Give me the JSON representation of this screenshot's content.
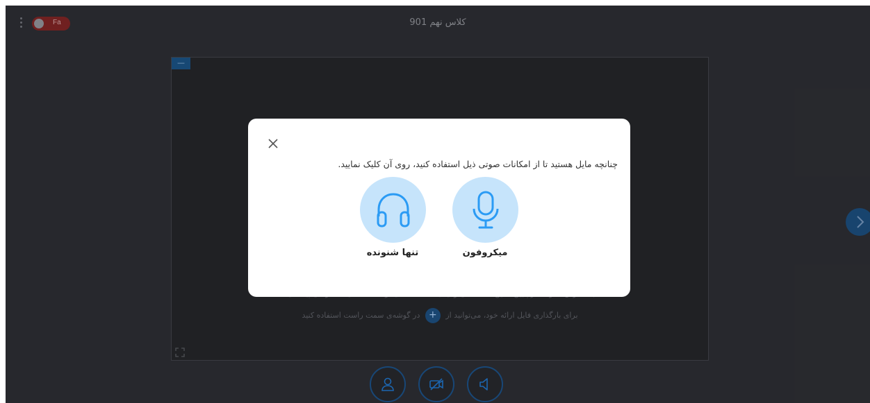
{
  "header": {
    "class_title": "کلاس نهم 901",
    "language_toggle": "Fa",
    "menu_icon": "kebab-menu-icon"
  },
  "stage": {
    "minimize_label": "—",
    "hint_line1": "با فشردن > و < در پایین همین صفحه می‌توانید به صفحه اسلاید و صفحه سفید دسترسی پیدا کنید",
    "hint_line2_before": "برای بارگذاری فایل ارائه خود، می‌توانید از",
    "hint_line2_plus": "+",
    "hint_line2_after": "در گوشه‌ی سمت راست استفاده کنید"
  },
  "audio_modal": {
    "message": "چنانچه مایل هستید تا از امکانات صوتی ذیل استفاده کنید، روی آن کلیک نمایید.",
    "options": [
      {
        "label": "میکروفون",
        "icon": "microphone-icon"
      },
      {
        "label": "تنها شنونده",
        "icon": "headphones-icon"
      }
    ]
  },
  "controls": {
    "icons": [
      "user-icon",
      "camera-off-icon",
      "speaker-icon"
    ]
  },
  "colors": {
    "background": "#2b2c31",
    "accent": "#1b4e82",
    "option_circle": "#c6e4fb",
    "icon_blue": "#2b9bf4"
  }
}
